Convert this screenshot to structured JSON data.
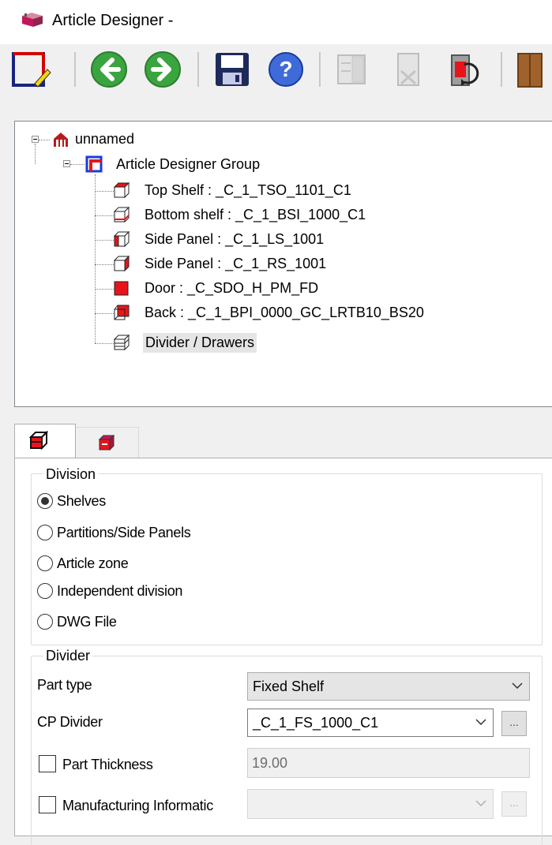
{
  "window": {
    "title": "Article Designer -"
  },
  "toolbar": {
    "buttons": [
      {
        "icon": "designer-frame-icon",
        "enabled": true
      },
      {
        "icon": "back-arrow-icon",
        "enabled": true
      },
      {
        "icon": "forward-arrow-icon",
        "enabled": true
      },
      {
        "icon": "save-icon",
        "enabled": true
      },
      {
        "icon": "help-icon",
        "enabled": true
      },
      {
        "icon": "cabinet-add-icon",
        "enabled": false
      },
      {
        "icon": "cabinet-remove-icon",
        "enabled": false
      },
      {
        "icon": "cabinet-rotate-icon",
        "enabled": true
      },
      {
        "icon": "wood-cabinet-icon",
        "enabled": true
      }
    ]
  },
  "tree": {
    "root": {
      "label": "unnamed",
      "icon": "article-root-icon"
    },
    "group": {
      "label": "Article Designer Group",
      "icon": "designer-group-icon"
    },
    "items": [
      {
        "label": "Top Shelf : _C_1_TSO_1101_C1",
        "icon": "top-shelf-icon"
      },
      {
        "label": "Bottom shelf : _C_1_BSI_1000_C1",
        "icon": "bottom-shelf-icon"
      },
      {
        "label": "Side Panel : _C_1_LS_1001",
        "icon": "left-side-panel-icon"
      },
      {
        "label": "Side Panel : _C_1_RS_1001",
        "icon": "right-side-panel-icon"
      },
      {
        "label": "Door : _C_SDO_H_PM_FD",
        "icon": "door-icon"
      },
      {
        "label": "Back : _C_1_BPI_0000_GC_LRTB10_BS20",
        "icon": "back-panel-icon"
      },
      {
        "label": "Divider / Drawers",
        "icon": "divider-drawers-icon"
      }
    ],
    "selected_index": 6
  },
  "tabs": [
    {
      "icon": "divider-tab-icon"
    },
    {
      "icon": "drawer-tab-icon"
    }
  ],
  "division": {
    "title": "Division",
    "options": [
      "Shelves",
      "Partitions/Side Panels",
      "Article zone",
      "Independent division",
      "DWG File"
    ],
    "selected": "Shelves"
  },
  "divider": {
    "title": "Divider",
    "part_type_label": "Part type",
    "part_type_value": "Fixed Shelf",
    "cp_divider_label": "CP Divider",
    "cp_divider_value": "_C_1_FS_1000_C1",
    "ellipsis_label": "...",
    "part_thickness_label": "Part Thickness",
    "part_thickness_value": "19.00",
    "manufacturing_label": "Manufacturing Informatic",
    "manufacturing_value": "",
    "manufacturing_ellipsis": "..."
  },
  "colors": {
    "selection": "#e5e5e5",
    "panel_red": "#e8141c",
    "border": "#828790"
  }
}
